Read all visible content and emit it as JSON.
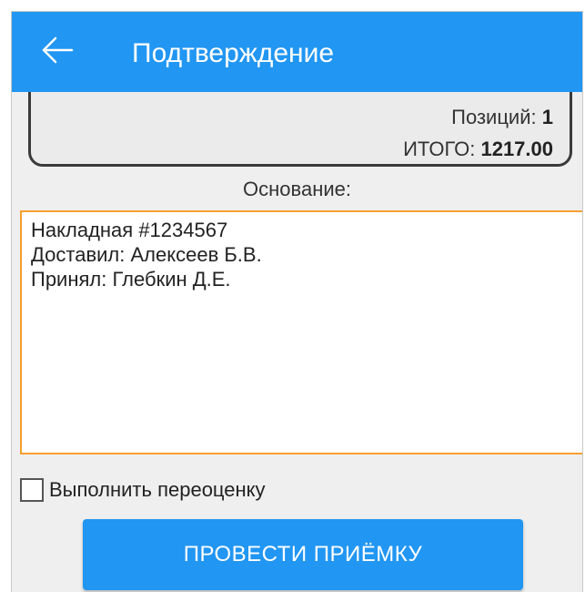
{
  "appbar": {
    "title": "Подтверждение",
    "back_icon": "arrow-left-icon",
    "color": "#2196f3"
  },
  "summary": {
    "positions_label": "Позиций:",
    "positions_value": "1",
    "total_label": "ИТОГО:",
    "total_value": "1217.00"
  },
  "basis": {
    "label": "Основание:",
    "text": "Накладная #1234567\nДоставил: Алексеев Б.В.\nПринял: Глебкин Д.Е.",
    "border_color": "#f5a030"
  },
  "revaluation": {
    "label": "Выполнить переоценку",
    "checked": false
  },
  "submit_button": {
    "label": "ПРОВЕСТИ ПРИЁМКУ",
    "color": "#2196f3"
  }
}
